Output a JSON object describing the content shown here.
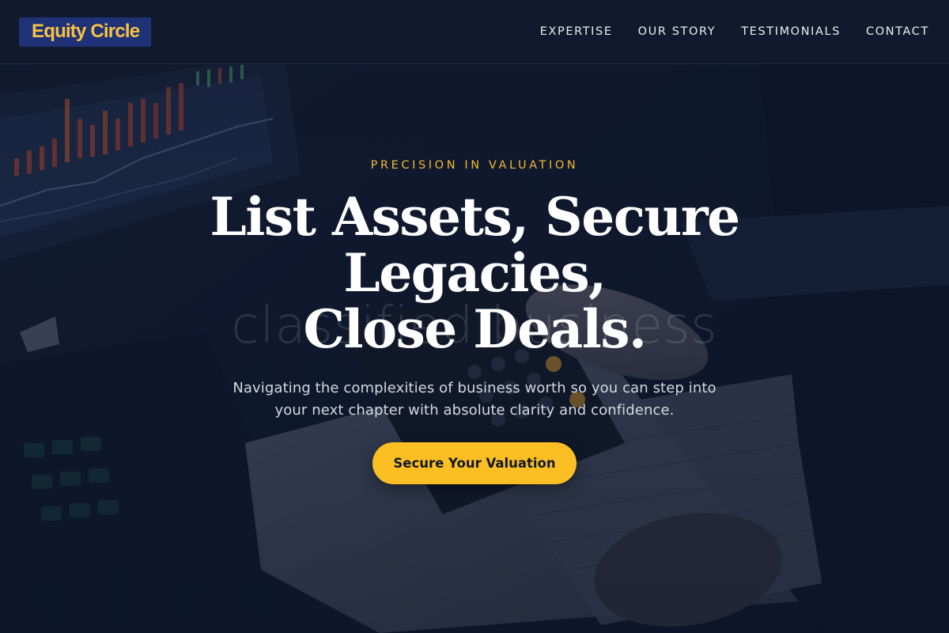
{
  "navbar": {
    "logo_text": "Equity Circle",
    "links": [
      "EXPERTISE",
      "OUR STORY",
      "TESTIMONIALS",
      "CONTACT"
    ]
  },
  "hero": {
    "eyebrow": "PRECISION IN VALUATION",
    "headline_lines": [
      "List Assets, Secure",
      "Legacies,",
      "Close Deals."
    ],
    "ghost_text": "classified business",
    "subtext_lines": [
      "Navigating the complexities of business worth so you can step into",
      "your next chapter with absolute clarity and confidence."
    ],
    "cta_label": "Secure Your Valuation"
  },
  "colors": {
    "accent": "#fbbf24",
    "eyebrow": "#f4b935",
    "logo_bg": "#1f3278",
    "navbar_bg": "#111a2c",
    "page_bg": "#0c1424"
  },
  "background_image": "financial-desk-photo"
}
